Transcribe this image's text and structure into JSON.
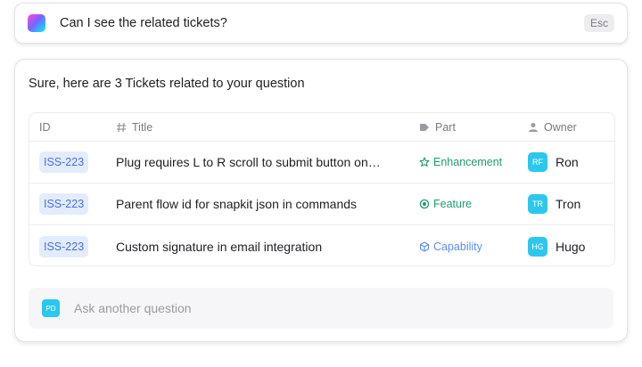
{
  "query": {
    "text": "Can I see the related tickets?",
    "esc_label": "Esc"
  },
  "answer": {
    "intro": "Sure, here are 3 Tickets related to your question"
  },
  "table": {
    "headers": {
      "id": "ID",
      "title": "Title",
      "part": "Part",
      "owner": "Owner"
    },
    "rows": [
      {
        "id": "ISS-223",
        "title": "Plug requires L to R scroll to submit button on…",
        "part": "Enhancement",
        "part_icon": "star-icon",
        "part_color": "#1f9d6b",
        "owner_initials": "RF",
        "owner": "Ron"
      },
      {
        "id": "ISS-223",
        "title": "Parent flow id for snapkit json in commands",
        "part": "Feature",
        "part_icon": "feature-icon",
        "part_color": "#1f9d6b",
        "owner_initials": "TR",
        "owner": "Tron"
      },
      {
        "id": "ISS-223",
        "title": "Custom signature in email integration",
        "part": "Capability",
        "part_icon": "cube-icon",
        "part_color": "#5b8def",
        "owner_initials": "HG",
        "owner": "Hugo"
      }
    ]
  },
  "ask": {
    "avatar_initials": "PD",
    "placeholder": "Ask another question"
  },
  "colors": {
    "id_chip_text": "#4a6fd8",
    "id_chip_bg": "#e3ecfd",
    "avatar_bg": "#2cc7ee"
  }
}
